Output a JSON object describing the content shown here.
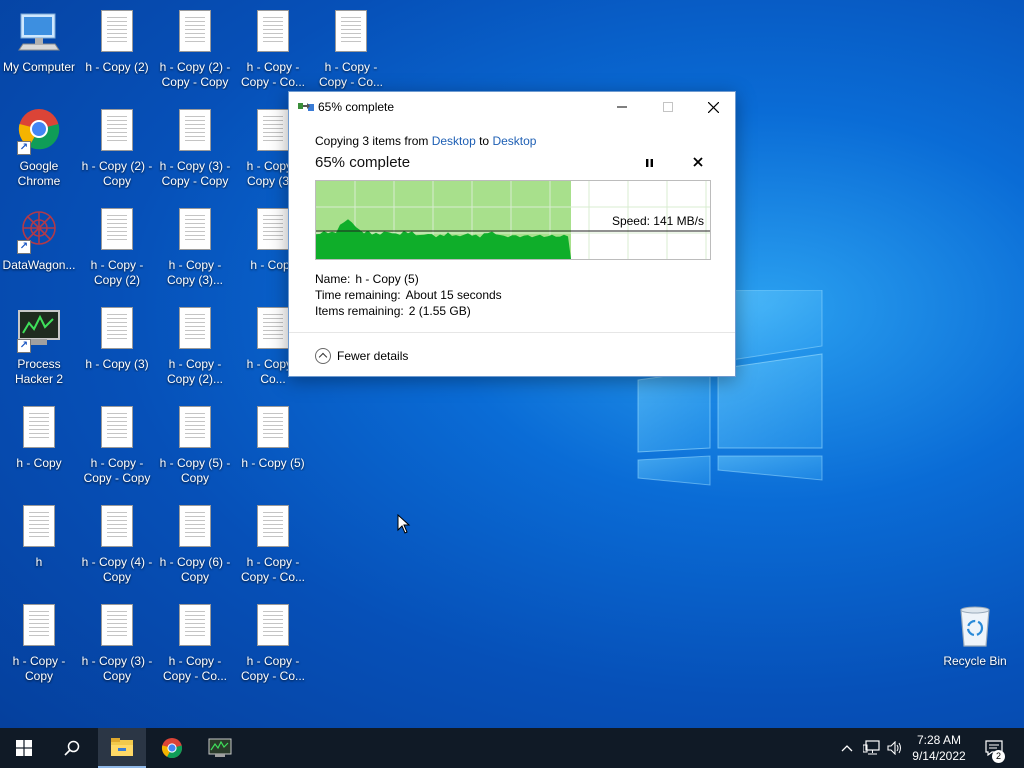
{
  "desktop": {
    "icons": [
      {
        "label": "My Computer",
        "kind": "computer"
      },
      {
        "label": "h - Copy (2)",
        "kind": "document"
      },
      {
        "label": "h - Copy (2) - Copy - Copy",
        "kind": "document"
      },
      {
        "label": "h - Copy - Copy - Co...",
        "kind": "document"
      },
      {
        "label": "h - Copy - Copy - Co...",
        "kind": "document"
      },
      {
        "label": "Google Chrome",
        "kind": "chrome-shortcut"
      },
      {
        "label": "h - Copy (2) - Copy",
        "kind": "document"
      },
      {
        "label": "h - Copy (3) - Copy - Copy",
        "kind": "document"
      },
      {
        "label": "h - Copy - Copy (3...",
        "kind": "document"
      },
      {
        "label": "DataWagon...",
        "kind": "datawagon-shortcut"
      },
      {
        "label": "h - Copy - Copy (2)",
        "kind": "document"
      },
      {
        "label": "h - Copy - Copy (3)...",
        "kind": "document"
      },
      {
        "label": "h - Copy",
        "kind": "document"
      },
      {
        "label": "Process Hacker 2",
        "kind": "processhacker-shortcut"
      },
      {
        "label": "h - Copy (3)",
        "kind": "document"
      },
      {
        "label": "h - Copy - Copy (2)...",
        "kind": "document"
      },
      {
        "label": "h - Copy - Co...",
        "kind": "document"
      },
      {
        "label": "h - Copy",
        "kind": "document"
      },
      {
        "label": "h - Copy - Copy - Copy",
        "kind": "document"
      },
      {
        "label": "h - Copy (5) - Copy",
        "kind": "document"
      },
      {
        "label": "h - Copy (5)",
        "kind": "document"
      },
      {
        "label": "h",
        "kind": "document"
      },
      {
        "label": "h - Copy (4) - Copy",
        "kind": "document"
      },
      {
        "label": "h - Copy (6) - Copy",
        "kind": "document"
      },
      {
        "label": "h - Copy - Copy - Co...",
        "kind": "document"
      },
      {
        "label": "h - Copy - Copy",
        "kind": "document"
      },
      {
        "label": "h - Copy (3) - Copy",
        "kind": "document"
      },
      {
        "label": "h - Copy - Copy - Co...",
        "kind": "document"
      },
      {
        "label": "h - Copy - Copy - Co...",
        "kind": "document"
      },
      {
        "label": "Recycle Bin",
        "kind": "recycle-bin"
      }
    ]
  },
  "dialog": {
    "title": "65% complete",
    "copying_prefix": "Copying 3 items from",
    "source": "Desktop",
    "to_word": "to",
    "destination": "Desktop",
    "status": "65% complete",
    "progress": 0.65,
    "speed_label": "Speed: 141 MB/s",
    "name_label": "Name:",
    "name_value": "h - Copy (5)",
    "time_label": "Time remaining:",
    "time_value": "About 15 seconds",
    "items_label": "Items remaining:",
    "items_value": "2 (1.55 GB)",
    "fewer_details": "Fewer details",
    "min_icon": "minimize-icon",
    "max_icon": "maximize-icon",
    "close_icon": "close-icon",
    "pause_icon": "pause-icon",
    "cancel_icon": "cancel-icon"
  },
  "taskbar": {
    "items": [
      "start-icon",
      "search-icon",
      "file-explorer-icon",
      "chrome-icon",
      "process-hacker-icon"
    ],
    "tray": [
      "chevron-up-icon",
      "network-icon",
      "volume-icon"
    ],
    "time": "7:28 AM",
    "date": "9/14/2022",
    "notification_count": "2"
  },
  "colors": {
    "progress_fill": "#a8e08c",
    "graph_fill": "#0fae2a",
    "link": "#1e5fb4",
    "taskbar": "#101a26"
  }
}
